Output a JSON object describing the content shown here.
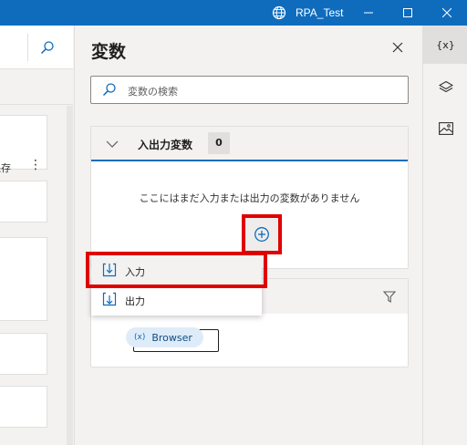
{
  "window": {
    "title": "RPA_Test"
  },
  "left": {
    "save_label": "保存"
  },
  "variables_panel": {
    "title": "変数",
    "search": {
      "placeholder": "変数の検索"
    },
    "io_section": {
      "title": "入出力変数",
      "count": "0",
      "empty_message": "ここにはまだ入力または出力の変数がありません"
    },
    "flow_section": {
      "chip_label": "Browser",
      "chip_icon": "(x)"
    }
  },
  "add_menu": {
    "items": [
      {
        "label": "入力",
        "icon": "input-arrow-icon"
      },
      {
        "label": "出力",
        "icon": "output-arrow-icon"
      }
    ]
  },
  "rail": {
    "variables_label": "{x}"
  },
  "colors": {
    "accent": "#0f6cbd",
    "highlight": "#e00000"
  }
}
